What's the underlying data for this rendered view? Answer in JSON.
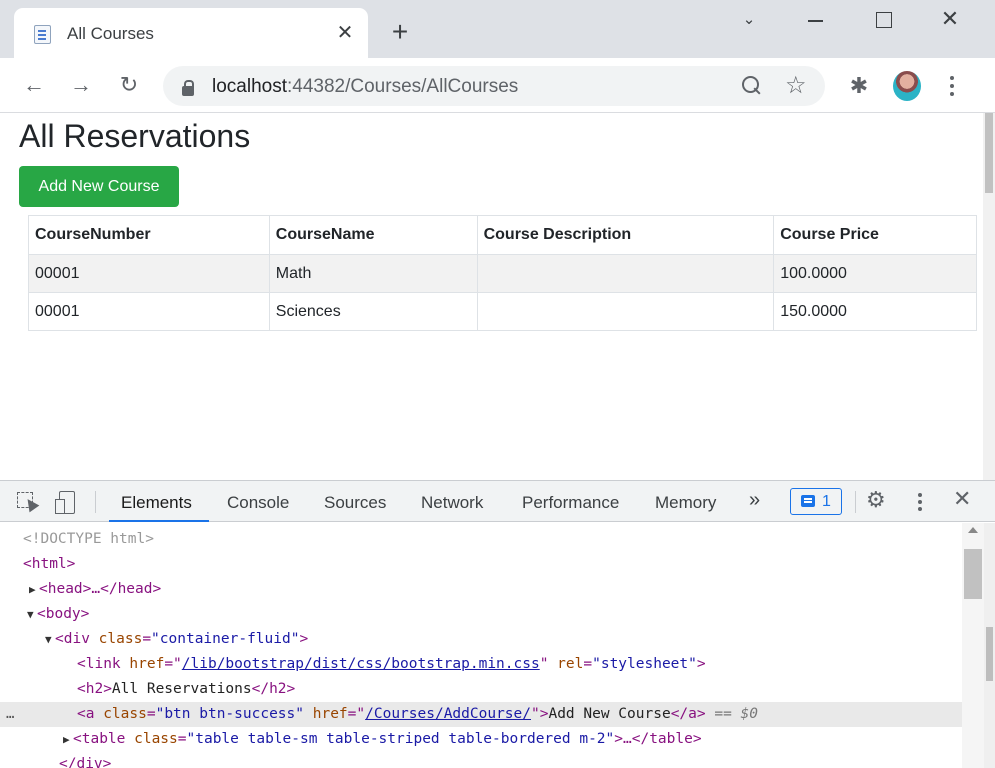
{
  "browser": {
    "tab_title": "All Courses",
    "tab_close": "✕",
    "new_tab": "+",
    "url_host": "localhost",
    "url_path": ":44382/Courses/AllCourses",
    "window_controls": {
      "chevron": "⌄",
      "close": "✕"
    },
    "nav": {
      "back": "←",
      "forward": "→",
      "reload": "↻"
    },
    "star": "☆",
    "extensions": "✱"
  },
  "page": {
    "heading": "All Reservations",
    "add_button": "Add New Course",
    "table": {
      "headers": [
        "CourseNumber",
        "CourseName",
        "Course Description",
        "Course Price"
      ],
      "rows": [
        [
          "00001",
          "Math",
          "",
          "100.0000"
        ],
        [
          "00001",
          "Sciences",
          "",
          "150.0000"
        ]
      ]
    }
  },
  "devtools": {
    "tabs": [
      "Elements",
      "Console",
      "Sources",
      "Network",
      "Performance",
      "Memory"
    ],
    "more": "»",
    "issues_count": "1",
    "gear": "⚙",
    "close": "✕",
    "dom": {
      "doctype": "<!DOCTYPE html>",
      "html_open": "<html>",
      "head": "<head>…</head>",
      "body_open": "<body>",
      "div_open_tag": "<div ",
      "div_attr": "class",
      "div_val": "\"container-fluid\"",
      "link_tag": "<link ",
      "link_href_attr": "href",
      "link_href": "/lib/bootstrap/dist/css/bootstrap.min.css",
      "link_rel_attr": "rel",
      "link_rel": "\"stylesheet\"",
      "h2_open": "<h2>",
      "h2_text": "All Reservations",
      "h2_close": "</h2>",
      "a_tag": "<a ",
      "a_class_attr": "class",
      "a_class": "\"btn btn-success\"",
      "a_href_attr": "href",
      "a_href": "/Courses/AddCourse/",
      "a_text": "Add New Course",
      "a_close": "</a>",
      "a_eq": "== $0",
      "table_tag": "<table ",
      "table_attr": "class",
      "table_val": "\"table table-sm table-striped table-bordered m-2\"",
      "table_rest": "…</table>",
      "div_close": "</div>",
      "dots": "…"
    }
  }
}
